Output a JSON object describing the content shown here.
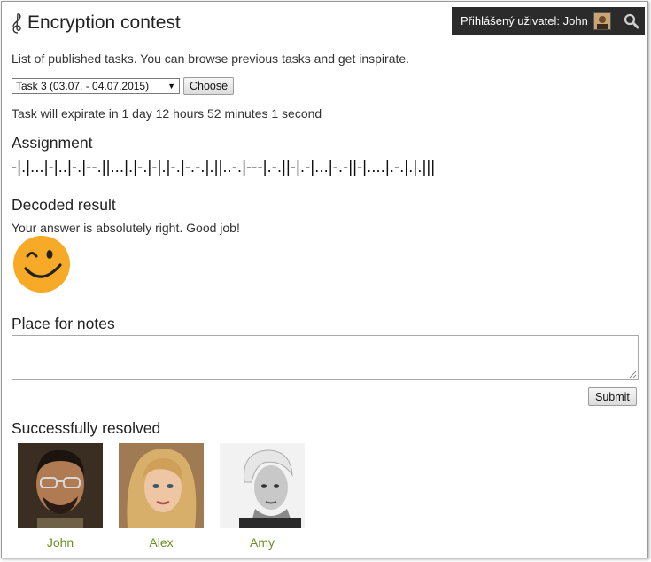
{
  "header": {
    "title": "Encryption contest",
    "user_label": "Přihlášený uživatel: John"
  },
  "intro_text": "List of published tasks. You can browse previous tasks and get inspirate.",
  "task_select": {
    "selected": "Task 3 (03.07. - 04.07.2015)",
    "choose_label": "Choose"
  },
  "expire_text": "Task will expirate in 1 day 12 hours 52 minutes 1 second",
  "assignment": {
    "heading": "Assignment",
    "code": "-|.|...|-|..|-.|--.||...|.|-.|-|.|-.|-.-.|.||..-.|---|.-.||-|.-|...|-.-||-|....|.-.|.|.|||"
  },
  "decoded": {
    "heading": "Decoded result",
    "message": "Your answer is absolutely right. Good job!"
  },
  "notes": {
    "heading": "Place for notes",
    "value": "",
    "submit_label": "Submit"
  },
  "resolved": {
    "heading": "Successfully resolved",
    "people": [
      {
        "name": "John"
      },
      {
        "name": "Alex"
      },
      {
        "name": "Amy"
      }
    ]
  },
  "colors": {
    "userbar_bg": "#2b2b2b",
    "name_link": "#6a8e23",
    "smiley": "#f7a928"
  }
}
